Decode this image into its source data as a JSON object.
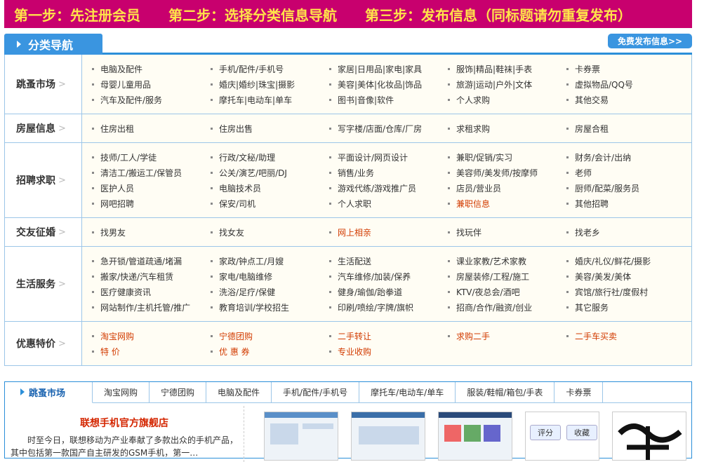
{
  "banner": {
    "steps": [
      "第一步：先注册会员",
      "第二步：选择分类信息导航",
      "第三步：发布信息（同标题请勿重复发布）"
    ]
  },
  "nav": {
    "title": "分类导航",
    "publish_button": "免费发布信息>>"
  },
  "categories": [
    {
      "title": "跳蚤市场",
      "items": [
        {
          "label": "电脑及配件"
        },
        {
          "label": "手机/配件/手机号"
        },
        {
          "label": "家居|日用品|家电|家具"
        },
        {
          "label": "服饰|精品|鞋袜|手表"
        },
        {
          "label": "卡券票"
        },
        {
          "label": "母婴儿童用品"
        },
        {
          "label": "婚庆|婚纱|珠宝|摄影"
        },
        {
          "label": "美容|美体|化妆品|饰品"
        },
        {
          "label": "旅游|运动|户外|文体"
        },
        {
          "label": "虚拟物品/QQ号"
        },
        {
          "label": "汽车及配件/服务"
        },
        {
          "label": "摩托车|电动车|单车"
        },
        {
          "label": "图书|音像|软件"
        },
        {
          "label": "个人求购"
        },
        {
          "label": "其他交易"
        }
      ]
    },
    {
      "title": "房屋信息",
      "items": [
        {
          "label": "住房出租"
        },
        {
          "label": "住房出售"
        },
        {
          "label": "写字楼/店面/仓库/厂房"
        },
        {
          "label": "求租求购"
        },
        {
          "label": "房屋合租"
        }
      ]
    },
    {
      "title": "招聘求职",
      "items": [
        {
          "label": "技师/工人/学徒"
        },
        {
          "label": "行政/文秘/助理"
        },
        {
          "label": "平面设计/网页设计"
        },
        {
          "label": "兼职/促销/实习"
        },
        {
          "label": "财务/会计/出纳"
        },
        {
          "label": "清洁工/搬运工/保管员"
        },
        {
          "label": "公关/演艺/吧丽/DJ"
        },
        {
          "label": "销售/业务"
        },
        {
          "label": "美容师/美发师/按摩师"
        },
        {
          "label": "老师"
        },
        {
          "label": "医护人员"
        },
        {
          "label": "电脑技术员"
        },
        {
          "label": "游戏代练/游戏推广员"
        },
        {
          "label": "店员/营业员"
        },
        {
          "label": "厨师/配菜/服务员"
        },
        {
          "label": "网吧招聘"
        },
        {
          "label": "保安/司机"
        },
        {
          "label": "个人求职"
        },
        {
          "label": "兼职信息",
          "red": true
        },
        {
          "label": "其他招聘"
        }
      ]
    },
    {
      "title": "交友征婚",
      "items": [
        {
          "label": "找男友"
        },
        {
          "label": "找女友"
        },
        {
          "label": "网上相亲",
          "red": true
        },
        {
          "label": "找玩伴"
        },
        {
          "label": "找老乡"
        }
      ]
    },
    {
      "title": "生活服务",
      "items": [
        {
          "label": "急开锁/管道疏通/堵漏"
        },
        {
          "label": "家政/钟点工/月嫂"
        },
        {
          "label": "生活配送"
        },
        {
          "label": "课业家教/艺术家教"
        },
        {
          "label": "婚庆/礼仪/鲜花/摄影"
        },
        {
          "label": "搬家/快递/汽车租赁"
        },
        {
          "label": "家电/电脑维修"
        },
        {
          "label": "汽车维修/加装/保养"
        },
        {
          "label": "房屋装修/工程/施工"
        },
        {
          "label": "美容/美发/美体"
        },
        {
          "label": "医疗健康资讯"
        },
        {
          "label": "洗浴/足疗/保健"
        },
        {
          "label": "健身/瑜伽/跆拳道"
        },
        {
          "label": "KTV/夜总会/酒吧"
        },
        {
          "label": "宾馆/旅行社/度假村"
        },
        {
          "label": "网站制作/主机托管/推广"
        },
        {
          "label": "教育培训/学校招生"
        },
        {
          "label": "印刷/喷绘/字牌/旗帜"
        },
        {
          "label": "招商/合作/融资/创业"
        },
        {
          "label": "其它服务"
        }
      ]
    },
    {
      "title": "优惠特价",
      "items": [
        {
          "label": "淘宝网购",
          "red": true
        },
        {
          "label": "宁德团购",
          "red": true
        },
        {
          "label": "二手转让",
          "red": true
        },
        {
          "label": "求购二手",
          "red": true
        },
        {
          "label": "二手车买卖",
          "red": true
        },
        {
          "label": "特 价",
          "red": true
        },
        {
          "label": "优 惠 券",
          "red": true
        },
        {
          "label": "专业收购",
          "red": true
        }
      ]
    }
  ],
  "market": {
    "title": "跳蚤市场",
    "tabs": [
      "淘宝网购",
      "宁德团购",
      "电脑及配件",
      "手机/配件/手机号",
      "摩托车/电动车/单车",
      "服装/鞋帽/箱包/手表",
      "卡券票"
    ],
    "promo_title": "联想手机官方旗舰店",
    "promo_text": "时至今日，联想移动为产业奉献了多款出众的手机产品，其中包括第一款国产自主研发的GSM手机，第一…",
    "thumb_buttons": [
      "评分",
      "收藏"
    ]
  }
}
